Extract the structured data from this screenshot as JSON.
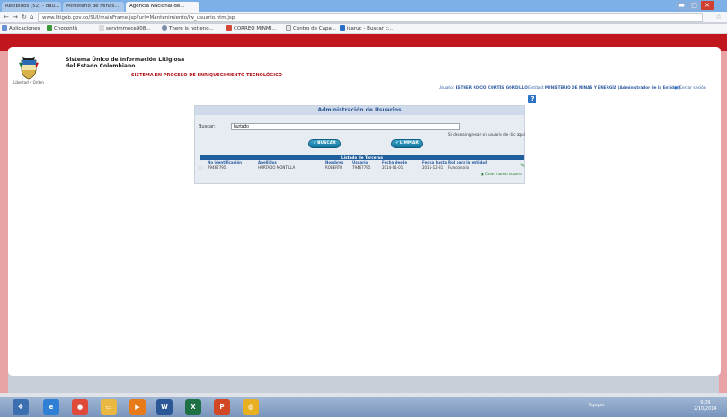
{
  "browser": {
    "tabs": [
      {
        "label": "Recibidos (52) - dau..."
      },
      {
        "label": "Ministerio de Minas..."
      },
      {
        "label": "Agencia Nacional de..."
      }
    ],
    "url": "www.litigob.gov.co/SUI/mainFrame.jsp?url=Mantenimiento/lw_usuario.htm.jsp",
    "bookmarks": [
      {
        "label": "Aplicaciones"
      },
      {
        "label": "Chocontá"
      },
      {
        "label": "servimmece908..."
      },
      {
        "label": "There is not eno..."
      },
      {
        "label": "CORREO MINMI..."
      },
      {
        "label": "Centro de Capa..."
      },
      {
        "label": "icaruc - Buscar c..."
      }
    ],
    "window_controls": {
      "minimize": "▬",
      "maximize": "□",
      "close": "✕"
    }
  },
  "header": {
    "system_title": "Sistema Único de Información Litigiosa del Estado Colombiano",
    "logo_caption": "Libertad y Orden",
    "subtitle": "SISTEMA EN PROCESO DE ENRIQUECIMIENTO TECNOLÓGICO",
    "user_label": "Usuario:",
    "user_name": "ESTHER ROCÍO CORTÉS GORDILLO",
    "entity_label": "Entidad:",
    "entity_name": "MINISTERIO DE MINAS Y ENERGÍA (Administrador de la Entidad)",
    "logout": "Cerrar sesión",
    "help": "?"
  },
  "panel": {
    "title": "Administración de Usuarios",
    "search_label": "Buscar:",
    "search_value": "hurtado",
    "hint": "Si desea ingresar un usuario de clic aquí",
    "search_button": "BUSCAR",
    "clear_button": "LIMPIAR",
    "list_title": "Listado de Terceros",
    "columns": [
      "No identificación",
      "Apellidos",
      "Nombres",
      "Usuario",
      "Fecha desde",
      "Fecha hasta",
      "Rol para la entidad"
    ],
    "rows": [
      [
        "79467795",
        "HURTADO MONTILLA",
        "ROBERTO",
        "79467795",
        "2014-01-01",
        "2015-12-31",
        "Funcionario"
      ]
    ],
    "new_user": "Crear nuevo usuario"
  },
  "taskbar": {
    "apps": [
      "Explorer",
      "IE",
      "Chrome",
      "Files",
      "Media",
      "Word",
      "Excel",
      "PowerPoint",
      "Other"
    ],
    "tray_text": "Equipo",
    "time": "9:09",
    "date": "2/10/2014"
  },
  "colors": {
    "accent_red": "#c1161d",
    "link_blue": "#2d5aa0",
    "button_teal": "#12709a"
  }
}
